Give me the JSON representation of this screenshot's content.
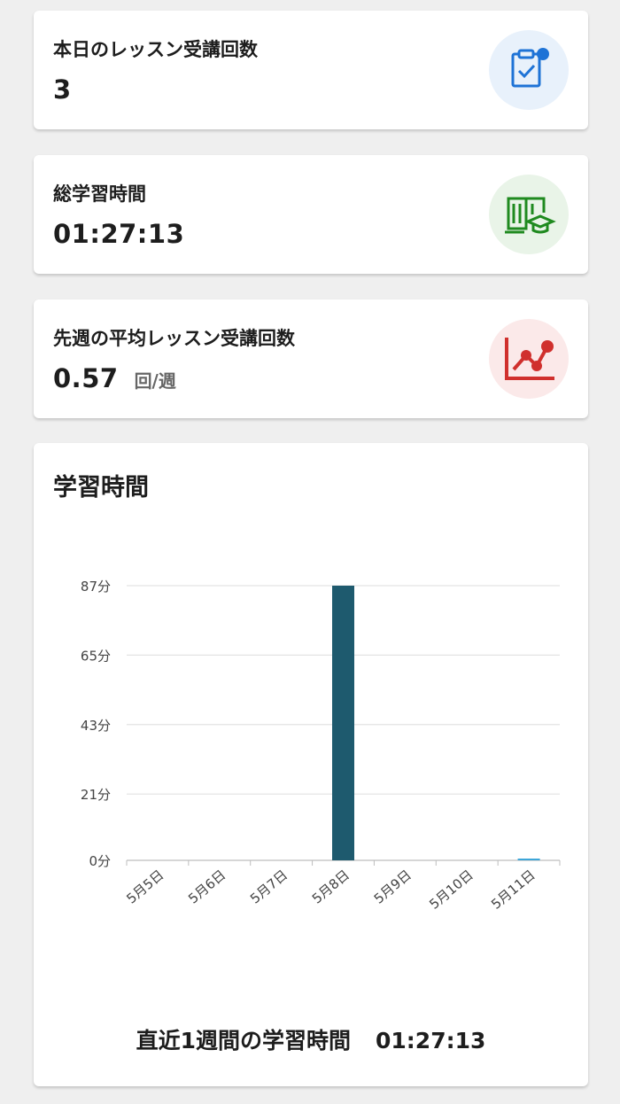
{
  "cards": [
    {
      "title": "本日のレッスン受講回数",
      "value": "3",
      "unit": "",
      "icon": "clipboard-check-icon",
      "color": "#1e73d6",
      "bg": "#e8f1fb"
    },
    {
      "title": "総学習時間",
      "value": "01:27:13",
      "unit": "",
      "icon": "book-graduation-icon",
      "color": "#1f8a1f",
      "bg": "#e9f4e8"
    },
    {
      "title": "先週の平均レッスン受講回数",
      "value": "0.57",
      "unit": "回/週",
      "icon": "line-chart-icon",
      "color": "#d0302d",
      "bg": "#fbe9e9"
    }
  ],
  "chart": {
    "title": "学習時間",
    "footer_label": "直近1週間の学習時間",
    "footer_value": "01:27:13"
  },
  "chart_data": {
    "type": "bar",
    "categories": [
      "5月5日",
      "5月6日",
      "5月7日",
      "5月8日",
      "5月9日",
      "5月10日",
      "5月11日"
    ],
    "values": [
      0,
      0,
      0,
      87,
      0,
      0,
      0.4
    ],
    "ylim": [
      0,
      87
    ],
    "yticks": [
      "0分",
      "21分",
      "43分",
      "65分",
      "87分"
    ],
    "ytick_values": [
      0,
      21,
      43,
      65,
      87
    ],
    "bar_color": "#1e5a6e",
    "highlight_color": "#3ea6d8",
    "grid": true
  }
}
